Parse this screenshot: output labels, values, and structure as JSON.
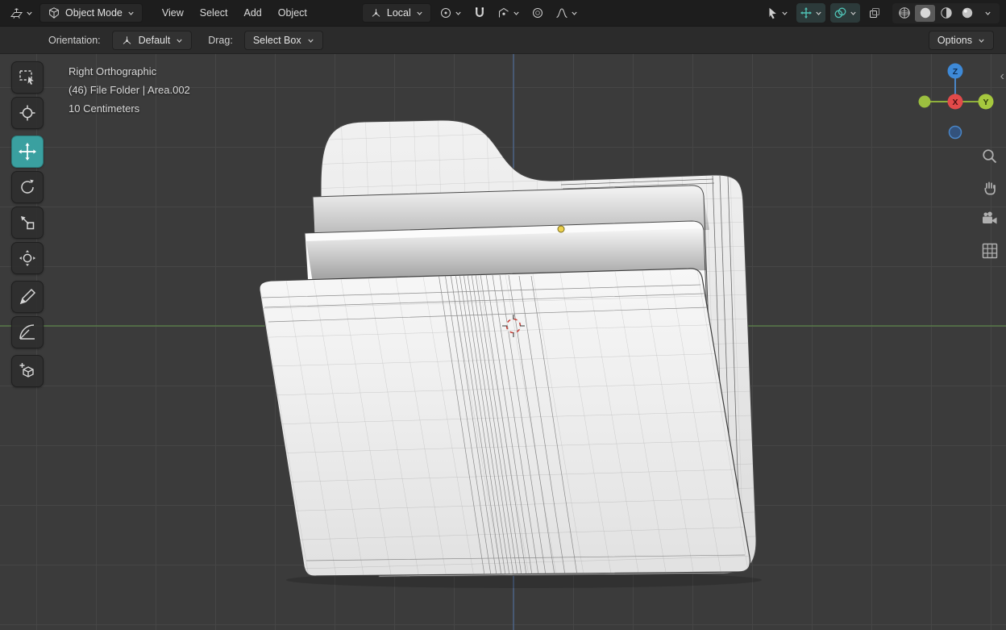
{
  "colors": {
    "accent_teal": "#3aa0a0",
    "icon_teal": "#4fc1b4",
    "axis_x": "#e24a4a",
    "axis_y": "#9cbf3f",
    "axis_z": "#3e8ad8",
    "origin_yellow": "#ecd04d",
    "header_bg": "#1d1d1d",
    "toolbar_bg": "#2b2b2b",
    "viewport_bg": "#3b3b3b",
    "grid_line": "#464646"
  },
  "header": {
    "mode_dropdown_label": "Object Mode",
    "menus": [
      {
        "label": "View"
      },
      {
        "label": "Select"
      },
      {
        "label": "Add"
      },
      {
        "label": "Object"
      }
    ],
    "orientation_dropdown_label": "Local"
  },
  "tool_settings": {
    "orientation_label": "Orientation:",
    "orientation_value": "Default",
    "drag_label": "Drag:",
    "drag_value": "Select Box",
    "options_label": "Options"
  },
  "viewport": {
    "info_line1": "Right Orthographic",
    "info_line2": "(46) File Folder | Area.002",
    "info_line3": "10 Centimeters",
    "gizmo": {
      "x_label": "X",
      "y_label": "Y",
      "z_label": "Z"
    },
    "sidebar_toggle_glyph": "‹"
  },
  "tools": [
    {
      "name": "box-select",
      "active": false
    },
    {
      "name": "cursor",
      "active": false
    },
    {
      "name": "move",
      "active": true
    },
    {
      "name": "rotate",
      "active": false
    },
    {
      "name": "scale",
      "active": false
    },
    {
      "name": "transform",
      "active": false
    },
    {
      "name": "annotate",
      "active": false
    },
    {
      "name": "measure",
      "active": false
    },
    {
      "name": "add-cube",
      "active": false
    }
  ],
  "icon_names": [
    "editor-type-icon",
    "object-mode-icon",
    "chevron-down-icon",
    "transform-orientation-icon",
    "pivot-point-icon",
    "snap-magnet-icon",
    "snap-target-icon",
    "proportional-editing-icon",
    "proportional-falloff-icon",
    "object-select-cursor-icon",
    "gizmo-toggle-icon",
    "overlays-toggle-icon",
    "xray-toggle-icon",
    "shading-wireframe-icon",
    "shading-solid-icon",
    "shading-material-icon",
    "shading-rendered-icon",
    "box-select-tool-icon",
    "cursor-tool-icon",
    "move-tool-icon",
    "rotate-tool-icon",
    "scale-tool-icon",
    "transform-tool-icon",
    "annotate-tool-icon",
    "measure-tool-icon",
    "add-cube-tool-icon",
    "zoom-icon",
    "pan-hand-icon",
    "camera-view-icon",
    "grid-view-icon"
  ]
}
